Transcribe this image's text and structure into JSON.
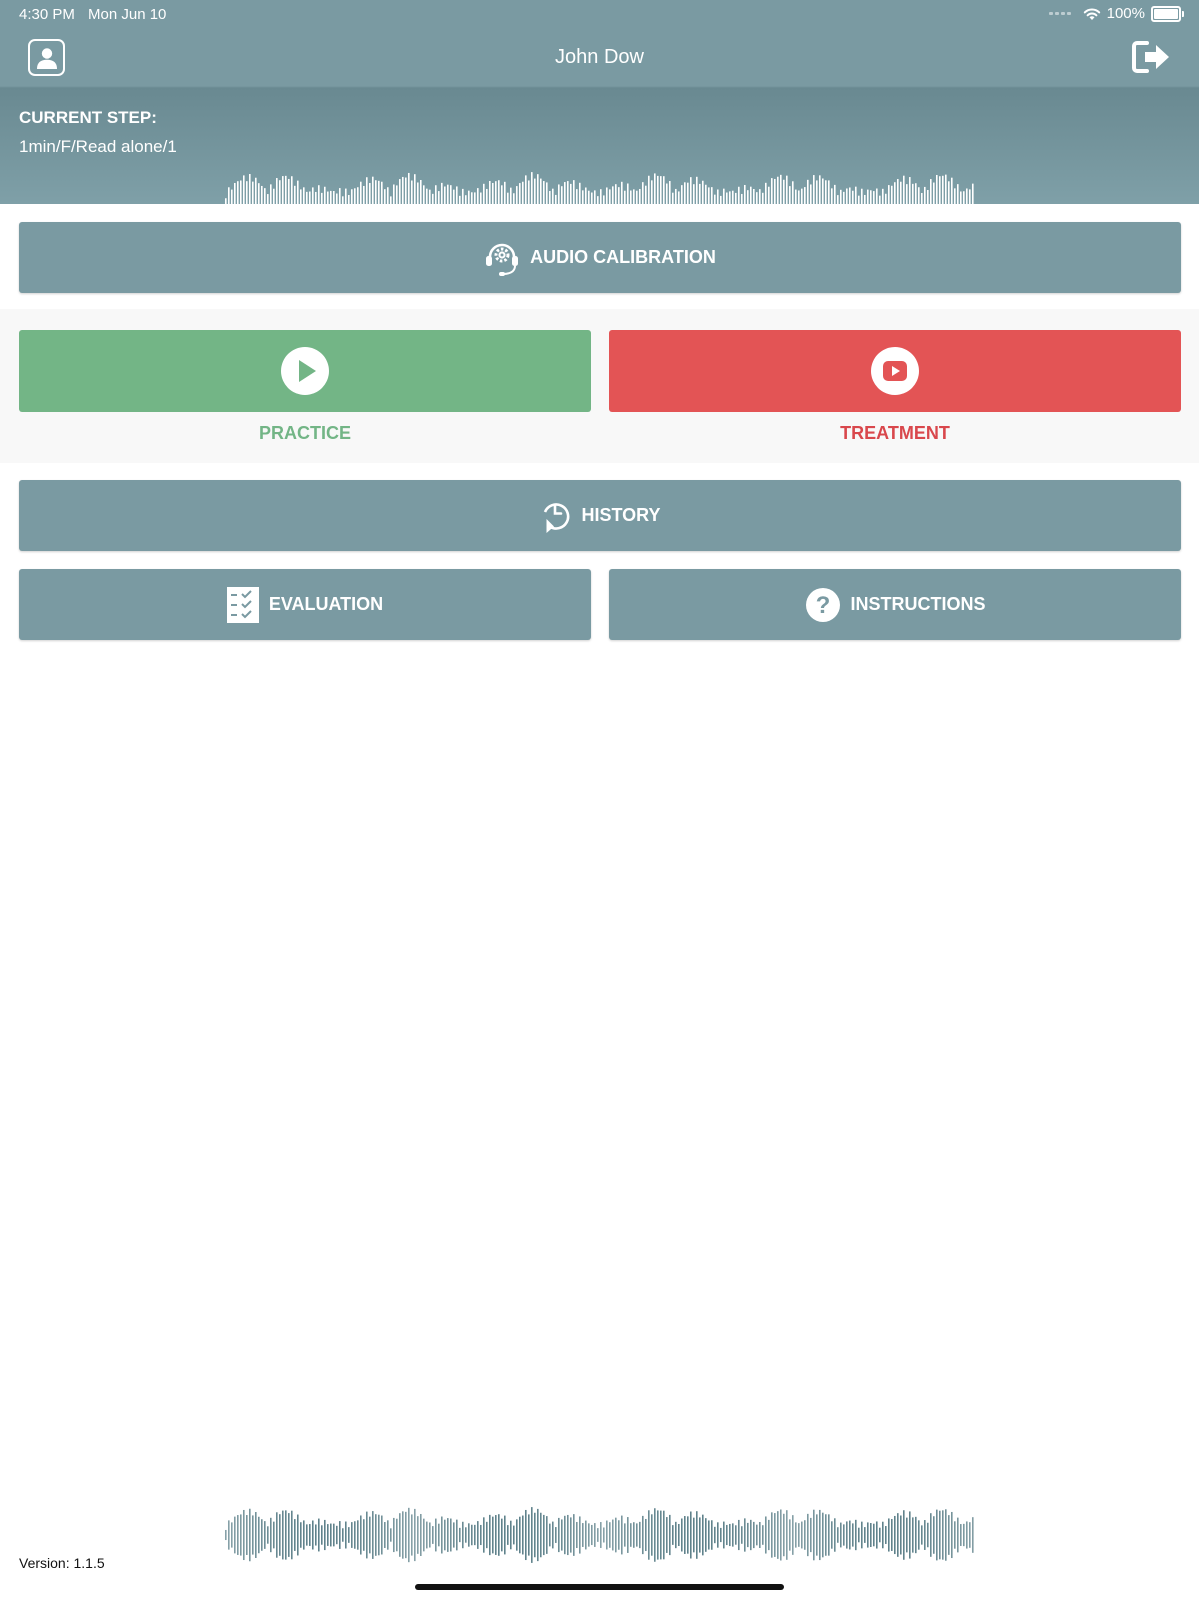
{
  "status_bar": {
    "time": "4:30 PM",
    "date": "Mon Jun 10",
    "battery_percent": "100%",
    "battery_level": 1.0
  },
  "nav": {
    "title": "John Dow",
    "left_icon": "user-profile-icon",
    "right_icon": "logout-icon"
  },
  "current_step": {
    "label": "CURRENT STEP:",
    "value": "1min/F/Read alone/1"
  },
  "buttons": {
    "audio_calibration": "AUDIO CALIBRATION",
    "practice": "PRACTICE",
    "treatment": "TREATMENT",
    "history": "HISTORY",
    "evaluation": "EVALUATION",
    "instructions": "INSTRUCTIONS"
  },
  "icons": {
    "audio_calibration": "headset-gear-icon",
    "practice": "play-circle-icon",
    "treatment": "video-play-icon",
    "history": "clock-history-icon",
    "evaluation": "checklist-icon",
    "instructions": "question-circle-icon"
  },
  "colors": {
    "header": "#7a9aa2",
    "button": "#7a9aa2",
    "practice": "#73b586",
    "treatment": "#e35455",
    "practice_text": "#73b586",
    "treatment_text": "#d9474c",
    "waveform_bottom": "#5f828b"
  },
  "footer": {
    "version": "Version: 1.1.5"
  }
}
